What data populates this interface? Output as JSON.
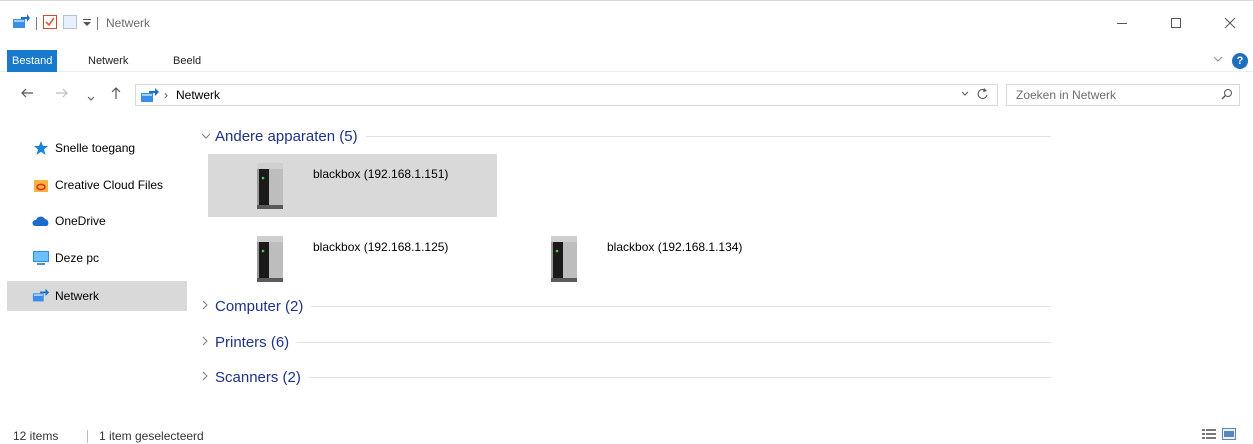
{
  "window": {
    "title": "Netwerk"
  },
  "ribbon": {
    "tabs": [
      {
        "label": "Bestand"
      },
      {
        "label": "Netwerk"
      },
      {
        "label": "Beeld"
      }
    ],
    "help_label": "?"
  },
  "address": {
    "path": "Netwerk"
  },
  "search": {
    "placeholder": "Zoeken in Netwerk"
  },
  "sidebar": {
    "items": [
      {
        "label": "Snelle toegang",
        "icon": "star-icon"
      },
      {
        "label": "Creative Cloud Files",
        "icon": "creative-cloud-icon"
      },
      {
        "label": "OneDrive",
        "icon": "onedrive-icon"
      },
      {
        "label": "Deze pc",
        "icon": "pc-icon"
      },
      {
        "label": "Netwerk",
        "icon": "network-icon",
        "selected": true
      }
    ]
  },
  "content": {
    "groups": [
      {
        "label": "Andere apparaten (5)",
        "expanded": true
      },
      {
        "label": "Computer (2)",
        "expanded": false
      },
      {
        "label": "Printers (6)",
        "expanded": false
      },
      {
        "label": "Scanners (2)",
        "expanded": false
      }
    ],
    "devices": [
      {
        "label": "blackbox (192.168.1.151)",
        "selected": true
      },
      {
        "label": "blackbox (192.168.1.125)",
        "selected": false
      },
      {
        "label": "blackbox (192.168.1.134)",
        "selected": false
      }
    ]
  },
  "status": {
    "items_count": "12 items",
    "selection": "1 item geselecteerd"
  },
  "colors": {
    "accent": "#1979ca",
    "group_label": "#1e3287",
    "selection": "#d9d9d9"
  }
}
